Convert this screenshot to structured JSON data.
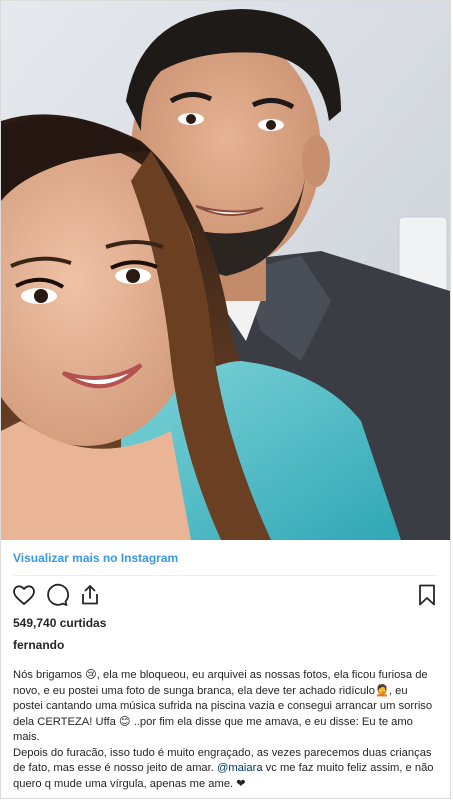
{
  "post": {
    "view_more_label": "Visualizar mais no Instagram",
    "likes": "549,740 curtidas",
    "author": "fernando",
    "caption": {
      "p1_a": "Nós brigamos ",
      "emoji_1": "😢",
      "p1_b": ", ela me bloqueou, eu arquivei as nossas fotos, ela ficou furiosa de novo, e eu postei uma foto de sunga branca, ela deve ter achado ridículo",
      "emoji_2": "🤦",
      "p1_c": ", eu postei cantando uma música sufrida na piscina vazia e consegui arrancar um sorriso dela CERTEZA! Uffa ",
      "emoji_3": "😊",
      "p1_d": " ..por fim ela disse que me amava, e eu disse: Eu te amo mais.",
      "p2_a": "Depois do furacão, isso tudo é muito engraçado, as vezes parecemos duas crianças de fato, mas esse é nosso jeito de amar. ",
      "mention": "@maiara",
      "p2_b": " vc me faz muito feliz assim, e não quero q mude uma vírgula, apenas me ame. ",
      "heart": "❤"
    }
  },
  "icons": {
    "like": "heart-outline-icon",
    "comment": "comment-bubble-icon",
    "share": "share-icon",
    "save": "bookmark-icon"
  },
  "colors": {
    "link": "#3897f0",
    "mention": "#003569",
    "text": "#262626",
    "border": "#dbdbdb"
  }
}
